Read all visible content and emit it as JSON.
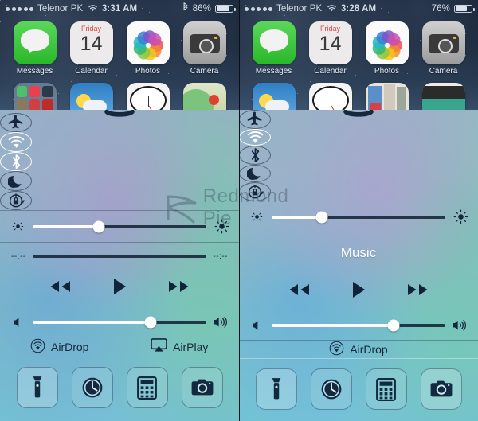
{
  "watermark": {
    "text": "Redmond Pie",
    "logo_icon": "redmondpie-r-logo"
  },
  "panels": [
    {
      "id": "left",
      "status_bar": {
        "signal_dots": 5,
        "carrier": "Telenor PK",
        "wifi_icon": "wifi-icon",
        "time": "3:31 AM",
        "bluetooth_icon": "bluetooth-icon",
        "bluetooth_visible": true,
        "battery_percent": "86%",
        "battery_level": 86
      },
      "home_apps_row1": [
        {
          "label": "Messages",
          "icon": "messages-icon"
        },
        {
          "label": "Calendar",
          "icon": "calendar-icon",
          "weekday": "Friday",
          "day": "14"
        },
        {
          "label": "Photos",
          "icon": "photos-icon"
        },
        {
          "label": "Camera",
          "icon": "camera-icon"
        }
      ],
      "home_apps_row2": [
        {
          "label": "",
          "icon": "folder-icon"
        },
        {
          "label": "",
          "icon": "weather-icon"
        },
        {
          "label": "",
          "icon": "clock-icon"
        },
        {
          "label": "",
          "icon": "maps-icon"
        }
      ],
      "control_center": {
        "grabber_icon": "grabber-handle-icon",
        "toggles": [
          {
            "name": "airplane-mode",
            "icon": "airplane-icon",
            "active": false
          },
          {
            "name": "wifi",
            "icon": "wifi-icon",
            "active": true
          },
          {
            "name": "bluetooth",
            "icon": "bluetooth-icon",
            "active": true
          },
          {
            "name": "do-not-disturb",
            "icon": "moon-icon",
            "active": false
          },
          {
            "name": "rotation-lock",
            "icon": "rotation-lock-icon",
            "active": false
          }
        ],
        "brightness": {
          "left_icon": "brightness-low-icon",
          "right_icon": "brightness-high-icon",
          "value": 38
        },
        "scrubber": {
          "visible": true,
          "elapsed": "--:--",
          "remaining": "--:--",
          "value": 0
        },
        "now_playing": {
          "visible": false,
          "title": ""
        },
        "transport": [
          {
            "name": "rewind-button",
            "icon": "rewind-icon"
          },
          {
            "name": "play-button",
            "icon": "play-icon"
          },
          {
            "name": "fast-forward-button",
            "icon": "fast-forward-icon"
          }
        ],
        "volume": {
          "left_icon": "volume-low-icon",
          "right_icon": "volume-high-icon",
          "value": 68
        },
        "air_row": [
          {
            "label": "AirDrop",
            "icon": "airdrop-icon"
          },
          {
            "label": "AirPlay",
            "icon": "airplay-icon"
          }
        ],
        "shortcuts": [
          {
            "name": "flashlight",
            "icon": "flashlight-icon",
            "highlight": true
          },
          {
            "name": "timer",
            "icon": "timer-icon",
            "highlight": false
          },
          {
            "name": "calculator",
            "icon": "calculator-icon",
            "highlight": false
          },
          {
            "name": "camera",
            "icon": "camera-icon",
            "highlight": false
          }
        ]
      }
    },
    {
      "id": "right",
      "status_bar": {
        "signal_dots": 5,
        "carrier": "Telenor PK",
        "wifi_icon": "wifi-icon",
        "time": "3:28 AM",
        "bluetooth_icon": "bluetooth-icon",
        "bluetooth_visible": false,
        "battery_percent": "76%",
        "battery_level": 76
      },
      "home_apps_row1": [
        {
          "label": "Messages",
          "icon": "messages-icon"
        },
        {
          "label": "Calendar",
          "icon": "calendar-icon",
          "weekday": "Friday",
          "day": "14"
        },
        {
          "label": "Photos",
          "icon": "photos-icon"
        },
        {
          "label": "Camera",
          "icon": "camera-icon"
        }
      ],
      "home_apps_row2": [
        {
          "label": "",
          "icon": "weather-icon"
        },
        {
          "label": "",
          "icon": "clock-icon"
        },
        {
          "label": "",
          "icon": "newsstand-icon"
        },
        {
          "label": "",
          "icon": "videos-icon"
        }
      ],
      "control_center": {
        "grabber_icon": "grabber-handle-icon",
        "toggles": [
          {
            "name": "airplane-mode",
            "icon": "airplane-icon",
            "active": false
          },
          {
            "name": "wifi",
            "icon": "wifi-icon",
            "active": true
          },
          {
            "name": "bluetooth",
            "icon": "bluetooth-icon",
            "active": false
          },
          {
            "name": "do-not-disturb",
            "icon": "moon-icon",
            "active": false
          },
          {
            "name": "rotation-lock",
            "icon": "rotation-lock-icon",
            "active": false
          }
        ],
        "brightness": {
          "left_icon": "brightness-low-icon",
          "right_icon": "brightness-high-icon",
          "value": 29
        },
        "scrubber": {
          "visible": false,
          "elapsed": "",
          "remaining": "",
          "value": 0
        },
        "now_playing": {
          "visible": true,
          "title": "Music"
        },
        "transport": [
          {
            "name": "rewind-button",
            "icon": "rewind-icon"
          },
          {
            "name": "play-button",
            "icon": "play-icon"
          },
          {
            "name": "fast-forward-button",
            "icon": "fast-forward-icon"
          }
        ],
        "volume": {
          "left_icon": "volume-low-icon",
          "right_icon": "volume-high-icon",
          "value": 70
        },
        "air_row": [
          {
            "label": "AirDrop",
            "icon": "airdrop-icon"
          }
        ],
        "shortcuts": [
          {
            "name": "flashlight",
            "icon": "flashlight-icon",
            "highlight": true
          },
          {
            "name": "timer",
            "icon": "timer-icon",
            "highlight": false
          },
          {
            "name": "calculator",
            "icon": "calculator-icon",
            "highlight": false
          },
          {
            "name": "camera",
            "icon": "camera-icon",
            "highlight": true
          }
        ]
      }
    }
  ]
}
